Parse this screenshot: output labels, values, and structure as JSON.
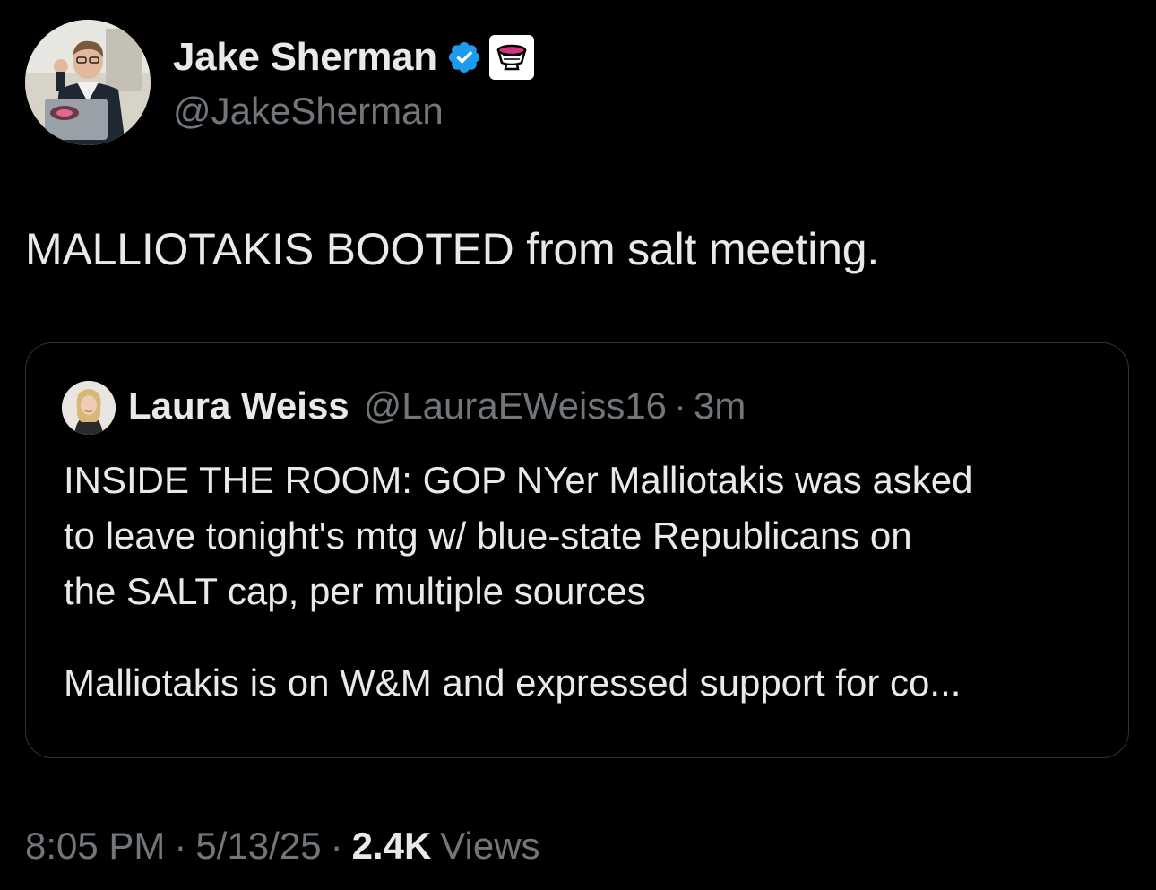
{
  "author": {
    "display_name": "Jake Sherman",
    "handle": "@JakeSherman",
    "verified_icon": "verified-badge-icon",
    "affiliate_icon": "punchbowl-affiliate-icon"
  },
  "tweet": {
    "text": "MALLIOTAKIS BOOTED from salt meeting."
  },
  "quoted_tweet": {
    "display_name": "Laura Weiss",
    "handle": "@LauraEWeiss16",
    "separator": "·",
    "time": "3m",
    "body_lines": [
      "INSIDE THE ROOM: GOP NYer Malliotakis was asked",
      "to leave tonight's mtg w/ blue-state Republicans on",
      "the SALT cap, per multiple sources"
    ],
    "body_second_paragraph": "Malliotakis is on W&M and expressed support for co..."
  },
  "meta": {
    "time": "8:05 PM",
    "separator": "·",
    "date": "5/13/25",
    "views_count": "2.4K",
    "views_label": "Views"
  },
  "colors": {
    "background": "#000000",
    "primary_text": "#e7e9ea",
    "secondary_text": "#71767b",
    "verified_blue": "#1d9bf0",
    "card_border": "#2f3336"
  }
}
